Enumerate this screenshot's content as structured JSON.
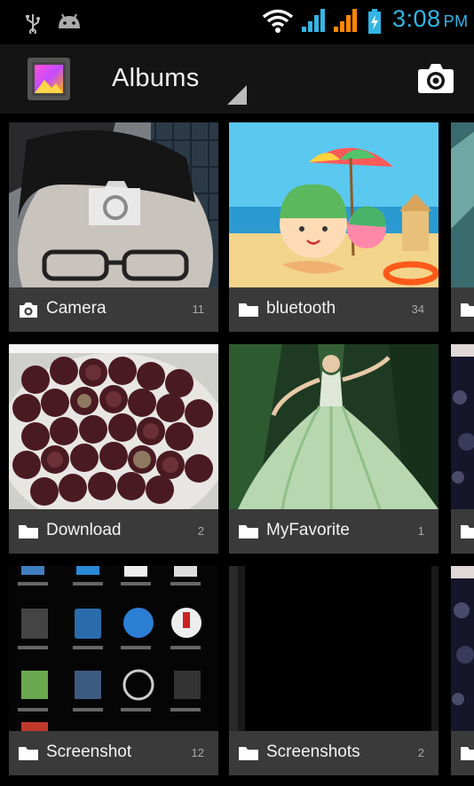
{
  "status_bar": {
    "time": "3:08",
    "ampm": "PM",
    "icons": [
      "usb-icon",
      "android-debug-icon",
      "wifi-icon",
      "signal-sim1-icon",
      "signal-sim2-icon",
      "battery-charging-icon"
    ],
    "time_color": "#33b5e5"
  },
  "action_bar": {
    "app_icon": "gallery-icon",
    "title": "Albums",
    "camera_icon": "camera-icon"
  },
  "albums": [
    {
      "name": "Camera",
      "count": "11",
      "icon": "camera-icon"
    },
    {
      "name": "bluetooth",
      "count": "34",
      "icon": "folder-icon"
    },
    {
      "name": "Download",
      "count": "2",
      "icon": "folder-icon"
    },
    {
      "name": "MyFavorite",
      "count": "1",
      "icon": "folder-icon"
    },
    {
      "name": "Screenshot",
      "count": "12",
      "icon": "folder-icon"
    },
    {
      "name": "Screenshots",
      "count": "2",
      "icon": "folder-icon"
    }
  ],
  "colors": {
    "background": "#000000",
    "action_bar": "#141414",
    "label_bar": "#3c3c3c"
  }
}
